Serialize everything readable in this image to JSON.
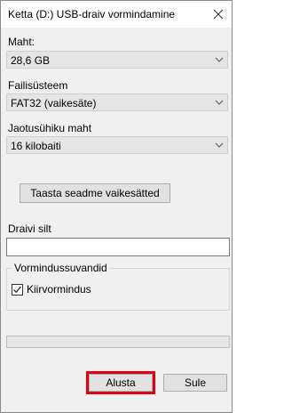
{
  "window": {
    "title": "Ketta (D:) USB-draiv vormindamine",
    "close_icon": "close-icon"
  },
  "capacity": {
    "label": "Maht:",
    "value": "28,6 GB"
  },
  "filesystem": {
    "label": "Failisüsteem",
    "value": "FAT32 (vaikesäte)"
  },
  "allocation": {
    "label": "Jaotusühiku maht",
    "value": "16 kilobaiti"
  },
  "restore_defaults_label": "Taasta seadme vaikesätted",
  "volume": {
    "label": "Draivi silt",
    "value": ""
  },
  "format_options": {
    "legend": "Vormindussuvandid",
    "quick_format_label": "Kiirvormindus",
    "quick_format_checked": true
  },
  "progress": {
    "fraction": 0
  },
  "buttons": {
    "start_label": "Alusta",
    "close_label": "Sule"
  },
  "colors": {
    "highlight": "#e3000f",
    "progress": "#06b025"
  }
}
